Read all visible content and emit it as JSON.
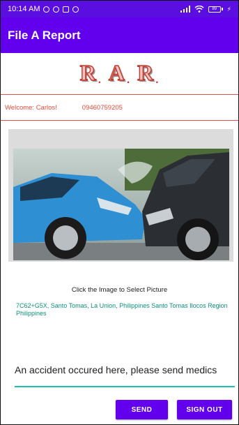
{
  "status_bar": {
    "time": "10:14 AM",
    "battery": "89"
  },
  "app_bar": {
    "title": "File A Report"
  },
  "logo": {
    "letters": [
      "R",
      "A",
      "R"
    ],
    "dot": "."
  },
  "user": {
    "welcome": "Welcome: Carlos!",
    "phone": "09460759205"
  },
  "photo": {
    "subject": "car-crash-photo"
  },
  "hint": "Click the Image to Select Picture",
  "location": {
    "address": "7C62+G5X, Santo Tomas, La Union, Philippines Santo Tomas Ilocos Region Philippines"
  },
  "report": {
    "message": "An accident occured here, please send medics"
  },
  "buttons": {
    "send": "SEND",
    "sign_out": "SIGN OUT"
  },
  "colors": {
    "primary": "#6200ee",
    "status_bar": "#5b0ee0",
    "accent_teal": "#1ac1b0",
    "welcome_red": "#e74c3c"
  }
}
